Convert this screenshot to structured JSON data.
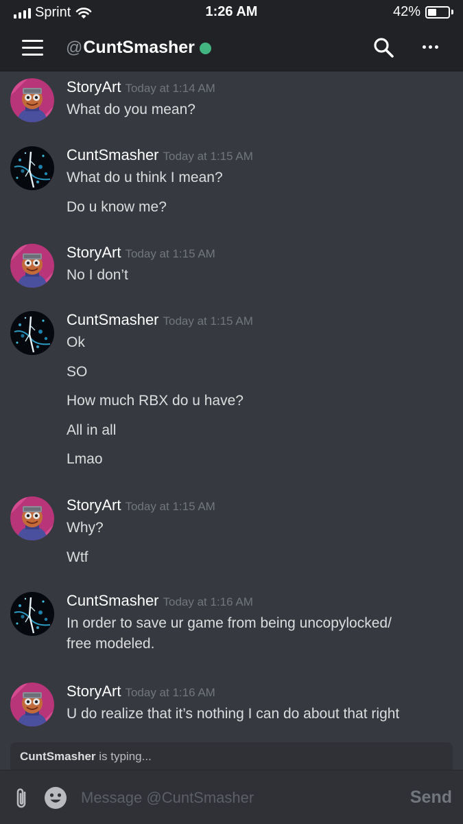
{
  "status_bar": {
    "carrier": "Sprint",
    "time": "1:26 AM",
    "battery": "42%",
    "battery_level": 0.42,
    "signal_bars": 4,
    "icons": [
      "signal-icon",
      "wifi-icon",
      "battery-icon"
    ]
  },
  "header": {
    "at_symbol": "@",
    "name": "CuntSmasher",
    "status_color": "#43b581",
    "icons": [
      "menu-icon",
      "search-icon",
      "more-icon"
    ]
  },
  "messages": [
    {
      "author": "StoryArt",
      "time": "Today at 1:14 AM",
      "avatar": "storyart-avatar",
      "lines": [
        "What do you mean?"
      ]
    },
    {
      "author": "CuntSmasher",
      "time": "Today at 1:15 AM",
      "avatar": "cuntsmasher-avatar",
      "lines": [
        "What do u think I mean?",
        "Do u know me?"
      ]
    },
    {
      "author": "StoryArt",
      "time": "Today at 1:15 AM",
      "avatar": "storyart-avatar",
      "lines": [
        "No I don’t"
      ]
    },
    {
      "author": "CuntSmasher",
      "time": "Today at 1:15 AM",
      "avatar": "cuntsmasher-avatar",
      "lines": [
        "Ok",
        "SO",
        "How much RBX do u have?",
        "All in all",
        "Lmao"
      ]
    },
    {
      "author": "StoryArt",
      "time": "Today at 1:15 AM",
      "avatar": "storyart-avatar",
      "lines": [
        "Why?",
        "Wtf"
      ]
    },
    {
      "author": "CuntSmasher",
      "time": "Today at 1:16 AM",
      "avatar": "cuntsmasher-avatar",
      "lines": [
        "In order to save ur game from being uncopylocked/",
        "free modeled."
      ]
    },
    {
      "author": "StoryArt",
      "time": "Today at 1:16 AM",
      "avatar": "storyart-avatar",
      "lines": [
        "U do realize that it’s nothing I can do about that right"
      ]
    }
  ],
  "typing": {
    "user": "CuntSmasher",
    "text": " is typing..."
  },
  "composer": {
    "placeholder": "Message @CuntSmasher",
    "send_label": "Send",
    "icons": [
      "attachment-icon",
      "emoji-icon"
    ]
  },
  "colors": {
    "background": "#36393f",
    "header": "#202225",
    "composer": "#2f3136",
    "online": "#43b581"
  }
}
